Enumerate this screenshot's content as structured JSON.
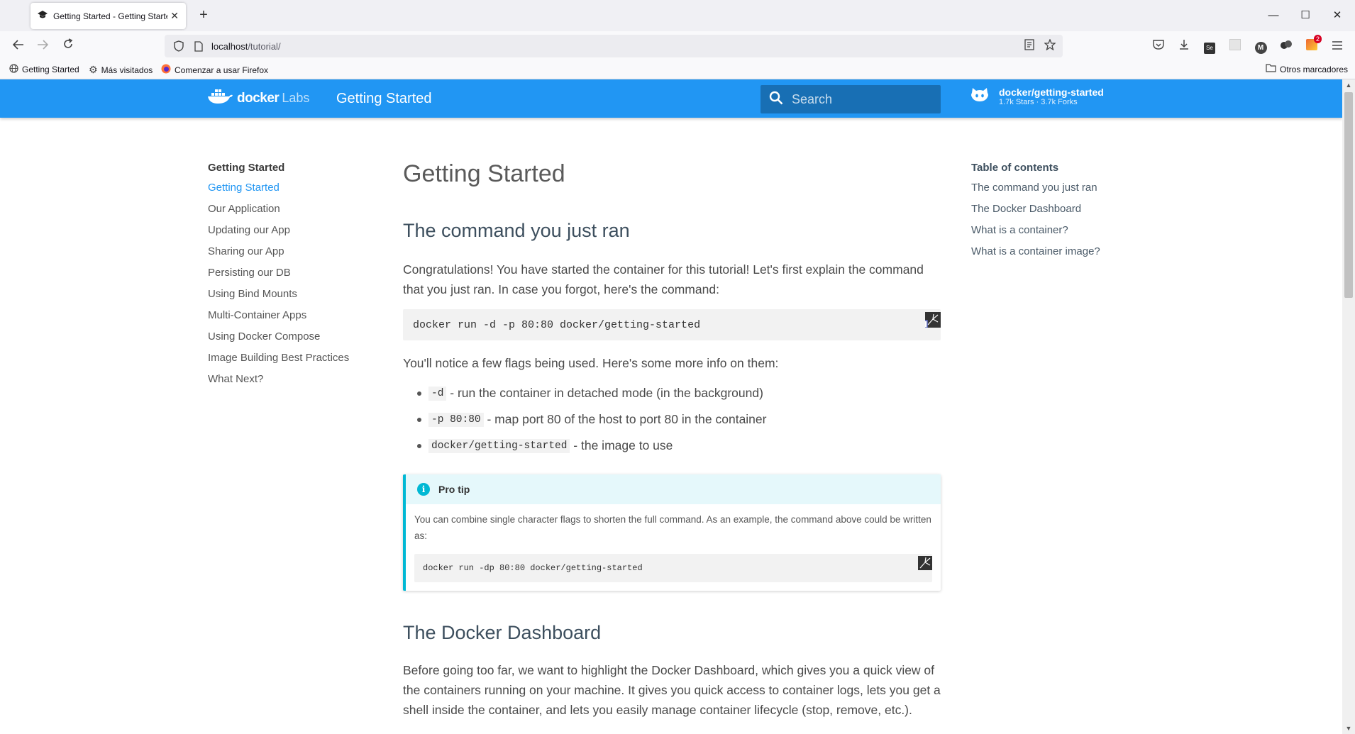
{
  "browser": {
    "tab_title": "Getting Started - Getting Started",
    "url_host": "localhost",
    "url_path": "/tutorial/",
    "bookmarks": [
      "Getting Started",
      "Más visitados",
      "Comenzar a usar Firefox"
    ],
    "other_bookmarks": "Otros marcadores",
    "extension_badge": "2",
    "extension_letter_m": "M",
    "extension_letter_se": "Se"
  },
  "header": {
    "logo_docker": "docker",
    "logo_labs": "Labs",
    "site_title": "Getting Started",
    "search_placeholder": "Search",
    "repo_name": "docker/getting-started",
    "repo_facts": "1.7k Stars · 3.7k Forks"
  },
  "sidenav": {
    "title": "Getting Started",
    "items": [
      "Getting Started",
      "Our Application",
      "Updating our App",
      "Sharing our App",
      "Persisting our DB",
      "Using Bind Mounts",
      "Multi-Container Apps",
      "Using Docker Compose",
      "Image Building Best Practices",
      "What Next?"
    ]
  },
  "content": {
    "title": "Getting Started",
    "section1_heading": "The command you just ran",
    "intro": "Congratulations! You have started the container for this tutorial! Let's first explain the command that you just ran. In case you forgot, here's the command:",
    "command": "docker run -d -p 80:80 docker/getting-started",
    "flags_intro": "You'll notice a few flags being used. Here's some more info on them:",
    "flags": [
      {
        "code": "-d",
        "text": " - run the container in detached mode (in the background)"
      },
      {
        "code": "-p 80:80",
        "text": " - map port 80 of the host to port 80 in the container"
      },
      {
        "code": "docker/getting-started",
        "text": " - the image to use"
      }
    ],
    "tip_title": "Pro tip",
    "tip_text": "You can combine single character flags to shorten the full command. As an example, the command above could be written as:",
    "tip_command": "docker run -dp 80:80 docker/getting-started",
    "section2_heading": "The Docker Dashboard",
    "dashboard_text": "Before going too far, we want to highlight the Docker Dashboard, which gives you a quick view of the containers running on your machine. It gives you quick access to container logs, lets you get a shell inside the container, and lets you easily manage container lifecycle (stop, remove, etc.)."
  },
  "toc": {
    "title": "Table of contents",
    "items": [
      "The command you just ran",
      "The Docker Dashboard",
      "What is a container?",
      "What is a container image?"
    ]
  },
  "colors": {
    "header": "#2196f3",
    "active_link": "#2196f3",
    "tip_accent": "#00b8d4"
  }
}
